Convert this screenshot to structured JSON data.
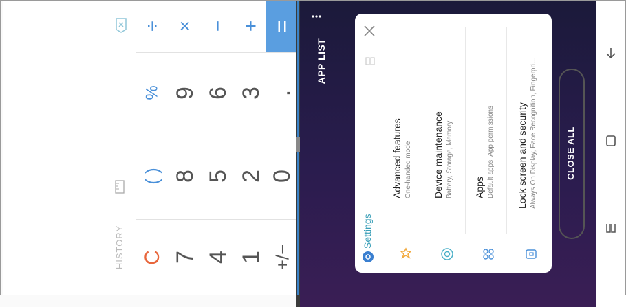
{
  "calculator": {
    "history_label": "HISTORY",
    "keys": [
      {
        "id": "clear",
        "label": "C"
      },
      {
        "id": "paren",
        "label": "( )"
      },
      {
        "id": "percent",
        "label": "%"
      },
      {
        "id": "divide",
        "label": "÷"
      },
      {
        "id": "seven",
        "label": "7"
      },
      {
        "id": "eight",
        "label": "8"
      },
      {
        "id": "nine",
        "label": "9"
      },
      {
        "id": "multiply",
        "label": "×"
      },
      {
        "id": "four",
        "label": "4"
      },
      {
        "id": "five",
        "label": "5"
      },
      {
        "id": "six",
        "label": "6"
      },
      {
        "id": "minus",
        "label": "−"
      },
      {
        "id": "one",
        "label": "1"
      },
      {
        "id": "two",
        "label": "2"
      },
      {
        "id": "three",
        "label": "3"
      },
      {
        "id": "plus",
        "label": "+"
      },
      {
        "id": "plusminus",
        "label": "+/−"
      },
      {
        "id": "zero",
        "label": "0"
      },
      {
        "id": "decimal",
        "label": "."
      },
      {
        "id": "equals",
        "label": "="
      }
    ]
  },
  "recents": {
    "title": "APP LIST",
    "close_all_label": "CLOSE ALL",
    "app": {
      "name": "Settings",
      "items": [
        {
          "title": "Advanced features",
          "subtitle": "One-handed mode"
        },
        {
          "title": "Device maintenance",
          "subtitle": "Battery, Storage, Memory"
        },
        {
          "title": "Apps",
          "subtitle": "Default apps, App permissions"
        },
        {
          "title": "Lock screen and security",
          "subtitle": "Always On Display, Face Recognition, Fingerpri..."
        }
      ]
    }
  },
  "colors": {
    "accent_blue": "#4a90d9",
    "clear_orange": "#e8663c",
    "equals_blue": "#5a9ee0",
    "recents_bg": "#2a1c4e",
    "settings_teal": "#3a9fb8",
    "settings_icon_orange": "#f2a93b"
  },
  "icons": [
    "backspace-icon",
    "ruler-icon",
    "more-vert-icon",
    "split-view-icon",
    "close-icon",
    "settings-gear-icon",
    "advanced-features-icon",
    "device-maintenance-icon",
    "apps-icon",
    "lock-icon",
    "back-icon",
    "home-icon",
    "recents-icon"
  ]
}
